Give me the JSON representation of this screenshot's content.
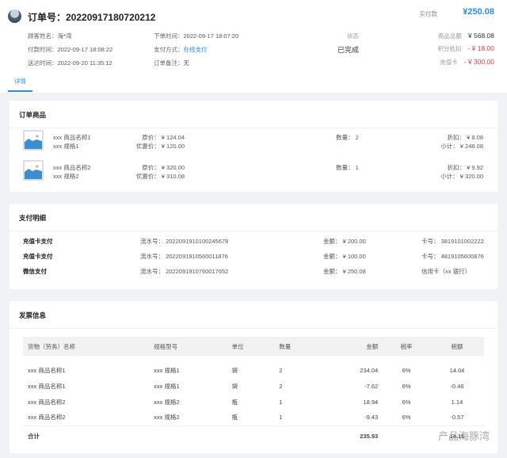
{
  "header": {
    "title": "订单号：20220917180720212",
    "fields": [
      {
        "k": "顾客姓名：",
        "v": "海*湾"
      },
      {
        "k": "下单时间：",
        "v": "2022-09-17 18:07:20"
      },
      {
        "k": "付款时间：",
        "v": "2022-09-17 18:08:22"
      },
      {
        "k": "支付方式：",
        "v": "在线支付"
      },
      {
        "k": "送达时间：",
        "v": "2022-09-20 11:35:12"
      },
      {
        "k": "订单备注：",
        "v": "无"
      }
    ],
    "paid_label": "实付款",
    "paid_value": "¥250.08",
    "status_label": "状态",
    "status_value": "已完成",
    "summary": [
      {
        "k": "商品总额",
        "v": "¥ 568.08"
      },
      {
        "k": "积分抵扣",
        "v": "- ¥ 18.00"
      },
      {
        "k": "充值卡",
        "v": "- ¥ 300.00"
      }
    ],
    "tab": "详情"
  },
  "goods": {
    "title": "订单商品",
    "items": [
      {
        "name": "xxx 商品名称1",
        "spec": "xxx 规格1",
        "orig": "原价：  ¥ 124.04",
        "sale": "优惠价：  ¥ 120.00",
        "qty": "数量：  2",
        "disc": "折扣：  ¥ 8.08",
        "sub": "小计：  ¥ 248.08"
      },
      {
        "name": "xxx 商品名称2",
        "spec": "xxx 规格2",
        "orig": "原价：  ¥ 320.00",
        "sale": "优惠价：  ¥ 310.08",
        "qty": "数量：  1",
        "disc": "折扣：  ¥ 9.92",
        "sub": "小计：  ¥ 320.00"
      }
    ]
  },
  "payment": {
    "title": "支付明细",
    "rows": [
      {
        "type": "充值卡支付",
        "serial": "流水号：  2022091910100245678",
        "amount": "金额：  ¥ 200.00",
        "card": "卡号：  3819101002222"
      },
      {
        "type": "充值卡支付",
        "serial": "流水号：  2022091910560011876",
        "amount": "金额：  ¥ 100.00",
        "card": "卡号：  4819105600876"
      },
      {
        "type": "微信支付",
        "serial": "流水号：  2022091910760017652",
        "amount": "金额：  ¥ 250.08",
        "card": "信用卡（xx 银行）"
      }
    ]
  },
  "invoice": {
    "title": "发票信息",
    "headers": [
      "货物（劳务）名称",
      "规格型号",
      "单位",
      "数量",
      "金额",
      "税率",
      "税额"
    ],
    "rows": [
      [
        "xxx 商品名称1",
        "xxx 规格1",
        "袋",
        "2",
        "234.04",
        "6%",
        "14.04"
      ],
      [
        "xxx 商品名称1",
        "xxx 规格1",
        "袋",
        "2",
        "-7.62",
        "6%",
        "-0.46"
      ],
      [
        "xxx 商品名称2",
        "xxx 规格2",
        "瓶",
        "1",
        "18.94",
        "6%",
        "1.14"
      ],
      [
        "xxx 商品名称2",
        "xxx 规格2",
        "瓶",
        "1",
        "-9.43",
        "6%",
        "-0.57"
      ]
    ],
    "total_label": "合计",
    "total_amount": "235.93",
    "total_tax": "14.15"
  },
  "watermark": "产品海豚湾"
}
